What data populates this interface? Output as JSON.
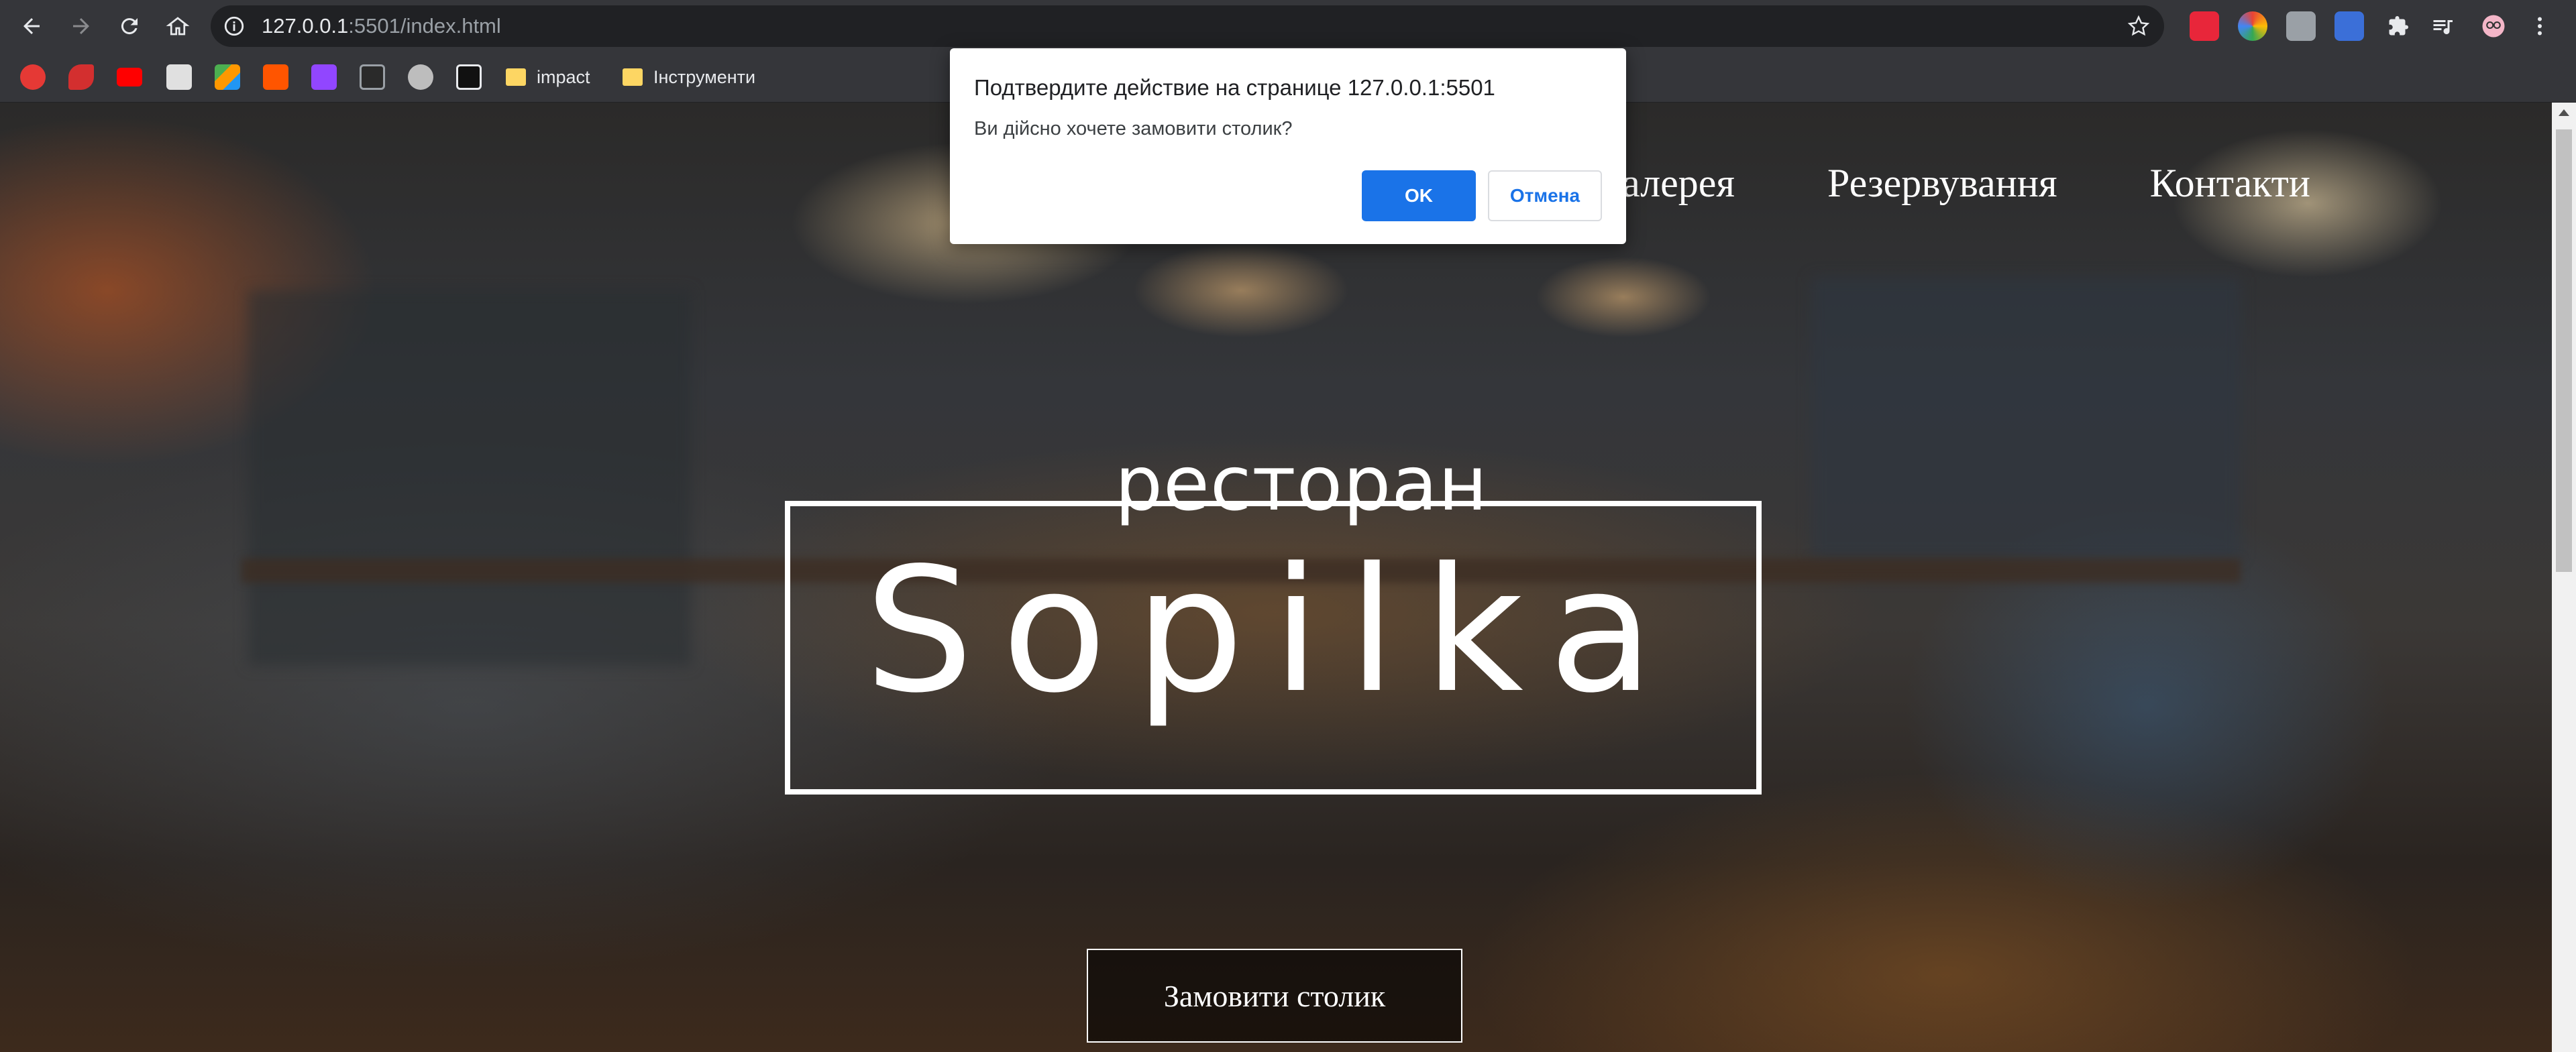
{
  "browser": {
    "url_host": "127.0.0.1",
    "url_path": ":5501/index.html",
    "bookmarks": {
      "folder_1": "impact",
      "folder_2": "Інструменти"
    }
  },
  "site": {
    "nav": [
      "Галерея",
      "Резервування",
      "Контакти"
    ],
    "hero_subtitle": "ресторан",
    "hero_title": "Sopilka",
    "cta_label": "Замовити столик"
  },
  "dialog": {
    "title": "Подтвердите действие на странице 127.0.0.1:5501",
    "message": "Ви дійсно хочете замовити столик?",
    "ok_label": "OK",
    "cancel_label": "Отмена"
  },
  "colors": {
    "chrome_bg": "#35363a",
    "omnibox_bg": "#202124",
    "accent": "#1a73e8"
  }
}
